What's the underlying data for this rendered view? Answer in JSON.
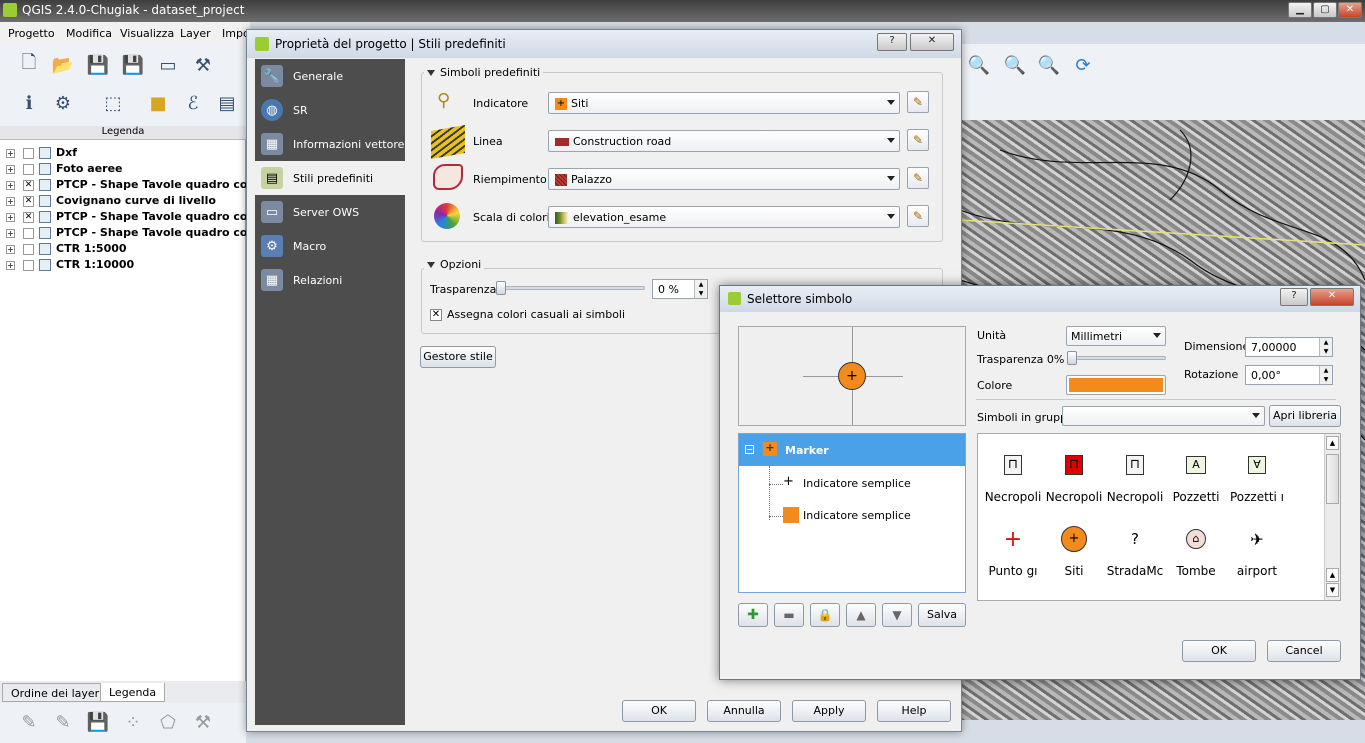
{
  "main_window": {
    "title": "QGIS 2.4.0-Chugiak - dataset_project",
    "menu": [
      "Progetto",
      "Modifica",
      "Visualizza",
      "Layer",
      "Impo"
    ]
  },
  "legend": {
    "header": "Legenda",
    "layers": [
      {
        "name": "Dxf",
        "checked": false
      },
      {
        "name": "Foto aeree",
        "checked": false
      },
      {
        "name": "PTCP - Shape  Tavole quadro cor",
        "checked": true
      },
      {
        "name": "Covignano curve di livello",
        "checked": true
      },
      {
        "name": "PTCP - Shape  Tavole quadro cor",
        "checked": true
      },
      {
        "name": "PTCP - Shape Tavole quadro cor",
        "checked": false
      },
      {
        "name": "CTR 1:5000",
        "checked": false
      },
      {
        "name": "CTR 1:10000",
        "checked": false
      }
    ],
    "tabs": [
      "Ordine dei layer",
      "Legenda"
    ]
  },
  "project_dialog": {
    "title": "Proprietà del progetto | Stili predefiniti",
    "help_btn": "?",
    "close_btn": "✕",
    "sidebar": [
      {
        "label": "Generale",
        "icon": "wrench-icon"
      },
      {
        "label": "SR",
        "icon": "globe-icon"
      },
      {
        "label": "Informazioni vettore",
        "icon": "vector-info-icon"
      },
      {
        "label": "Stili predefiniti",
        "icon": "styles-icon"
      },
      {
        "label": "Server OWS",
        "icon": "server-icon"
      },
      {
        "label": "Macro",
        "icon": "macro-icon"
      },
      {
        "label": "Relazioni",
        "icon": "relations-icon"
      }
    ],
    "symbols_group": {
      "title": "Simboli predefiniti",
      "rows": [
        {
          "label": "Indicatore",
          "value": "Siti",
          "swatch": "#f28a1e"
        },
        {
          "label": "Linea",
          "value": "Construction road",
          "swatch": "#a52a2a"
        },
        {
          "label": "Riempimento",
          "value": "Palazzo",
          "swatch": "#c0392b"
        },
        {
          "label": "Scala di colori",
          "value": "elevation_esame",
          "swatch": "#6b8e23"
        }
      ]
    },
    "options_group": {
      "title": "Opzioni",
      "transparency_label": "Trasparenza",
      "transparency_value": "0 %",
      "random_colors_label": "Assegna colori casuali ai simboli",
      "random_colors_checked": true
    },
    "style_manager_btn": "Gestore stile",
    "buttons": {
      "ok": "OK",
      "cancel": "Annulla",
      "apply": "Apply",
      "help": "Help"
    }
  },
  "symbol_dialog": {
    "title": "Selettore simbolo",
    "help_btn": "?",
    "close_btn": "✕",
    "unit_label": "Unità",
    "unit_value": "Millimetri",
    "transparency_label": "Trasparenza 0%",
    "color_label": "Colore",
    "color_value": "#f28a1e",
    "size_label": "Dimensione",
    "size_value": "7,00000",
    "rotation_label": "Rotazione",
    "rotation_value": "0,00°",
    "group_label": "Simboli in gruppo",
    "group_value": "",
    "open_library_btn": "Apri libreria",
    "tree": {
      "root": "Marker",
      "children": [
        "Indicatore semplice",
        "Indicatore semplice"
      ]
    },
    "save_btn": "Salva",
    "symbols": [
      {
        "name": "Necropoli",
        "glyph": "⊓"
      },
      {
        "name": "Necropoli",
        "glyph": "⊓"
      },
      {
        "name": "Necropoli",
        "glyph": "⊓"
      },
      {
        "name": "Pozzetti",
        "glyph": "A"
      },
      {
        "name": "Pozzetti ı",
        "glyph": "∀"
      },
      {
        "name": "Punto gı",
        "glyph": "+"
      },
      {
        "name": "Siti",
        "glyph": "+"
      },
      {
        "name": "StradaMc",
        "glyph": "?"
      },
      {
        "name": "Tombe",
        "glyph": "⌂"
      },
      {
        "name": "airport",
        "glyph": "✈"
      }
    ],
    "buttons": {
      "ok": "OK",
      "cancel": "Cancel"
    }
  }
}
